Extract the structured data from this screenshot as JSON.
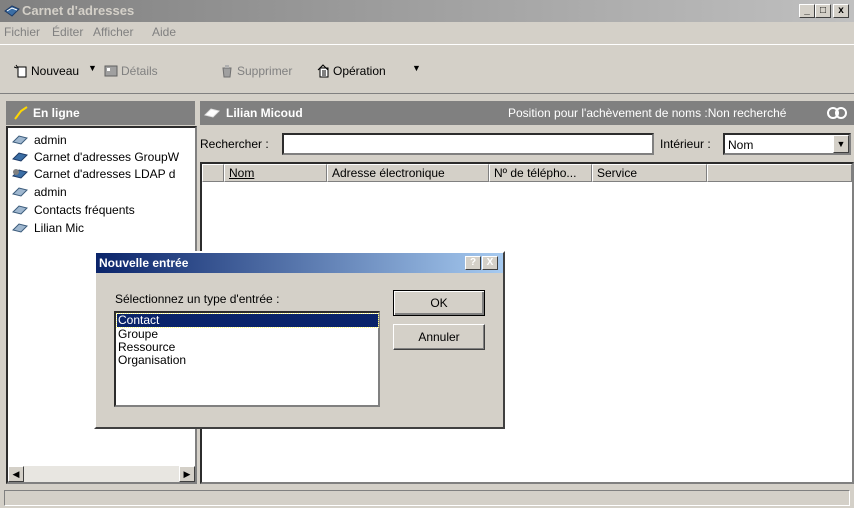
{
  "window": {
    "title": "Carnet d'adresses"
  },
  "menu": {
    "items": [
      "Fichier",
      "Éditer",
      "Afficher",
      "Aide"
    ]
  },
  "toolbar": {
    "new_label": "Nouveau",
    "details_label": "Détails",
    "delete_label": "Supprimer",
    "operation_label": "Opération"
  },
  "left_pane": {
    "header": "En ligne",
    "items": [
      "admin",
      "Carnet d'adresses GroupW",
      "Carnet d'adresses LDAP d",
      "admin",
      "Contacts fréquents",
      "Lilian Mic"
    ]
  },
  "right_pane": {
    "header": "Lilian Micoud",
    "completion_text": "Position pour l'achèvement de noms :Non recherché",
    "search_label": "Rechercher :",
    "search_value": "",
    "within_label": "Intérieur :",
    "within_value": "Nom",
    "columns": [
      "Nom",
      "Adresse électronique",
      "Nº de télépho...",
      "Service"
    ]
  },
  "dialog": {
    "title": "Nouvelle entrée",
    "help_label": "?",
    "close_label": "X",
    "prompt": "Sélectionnez un type d'entrée :",
    "options": [
      "Contact",
      "Groupe",
      "Ressource",
      "Organisation"
    ],
    "selected": "Contact",
    "ok_label": "OK",
    "cancel_label": "Annuler"
  }
}
